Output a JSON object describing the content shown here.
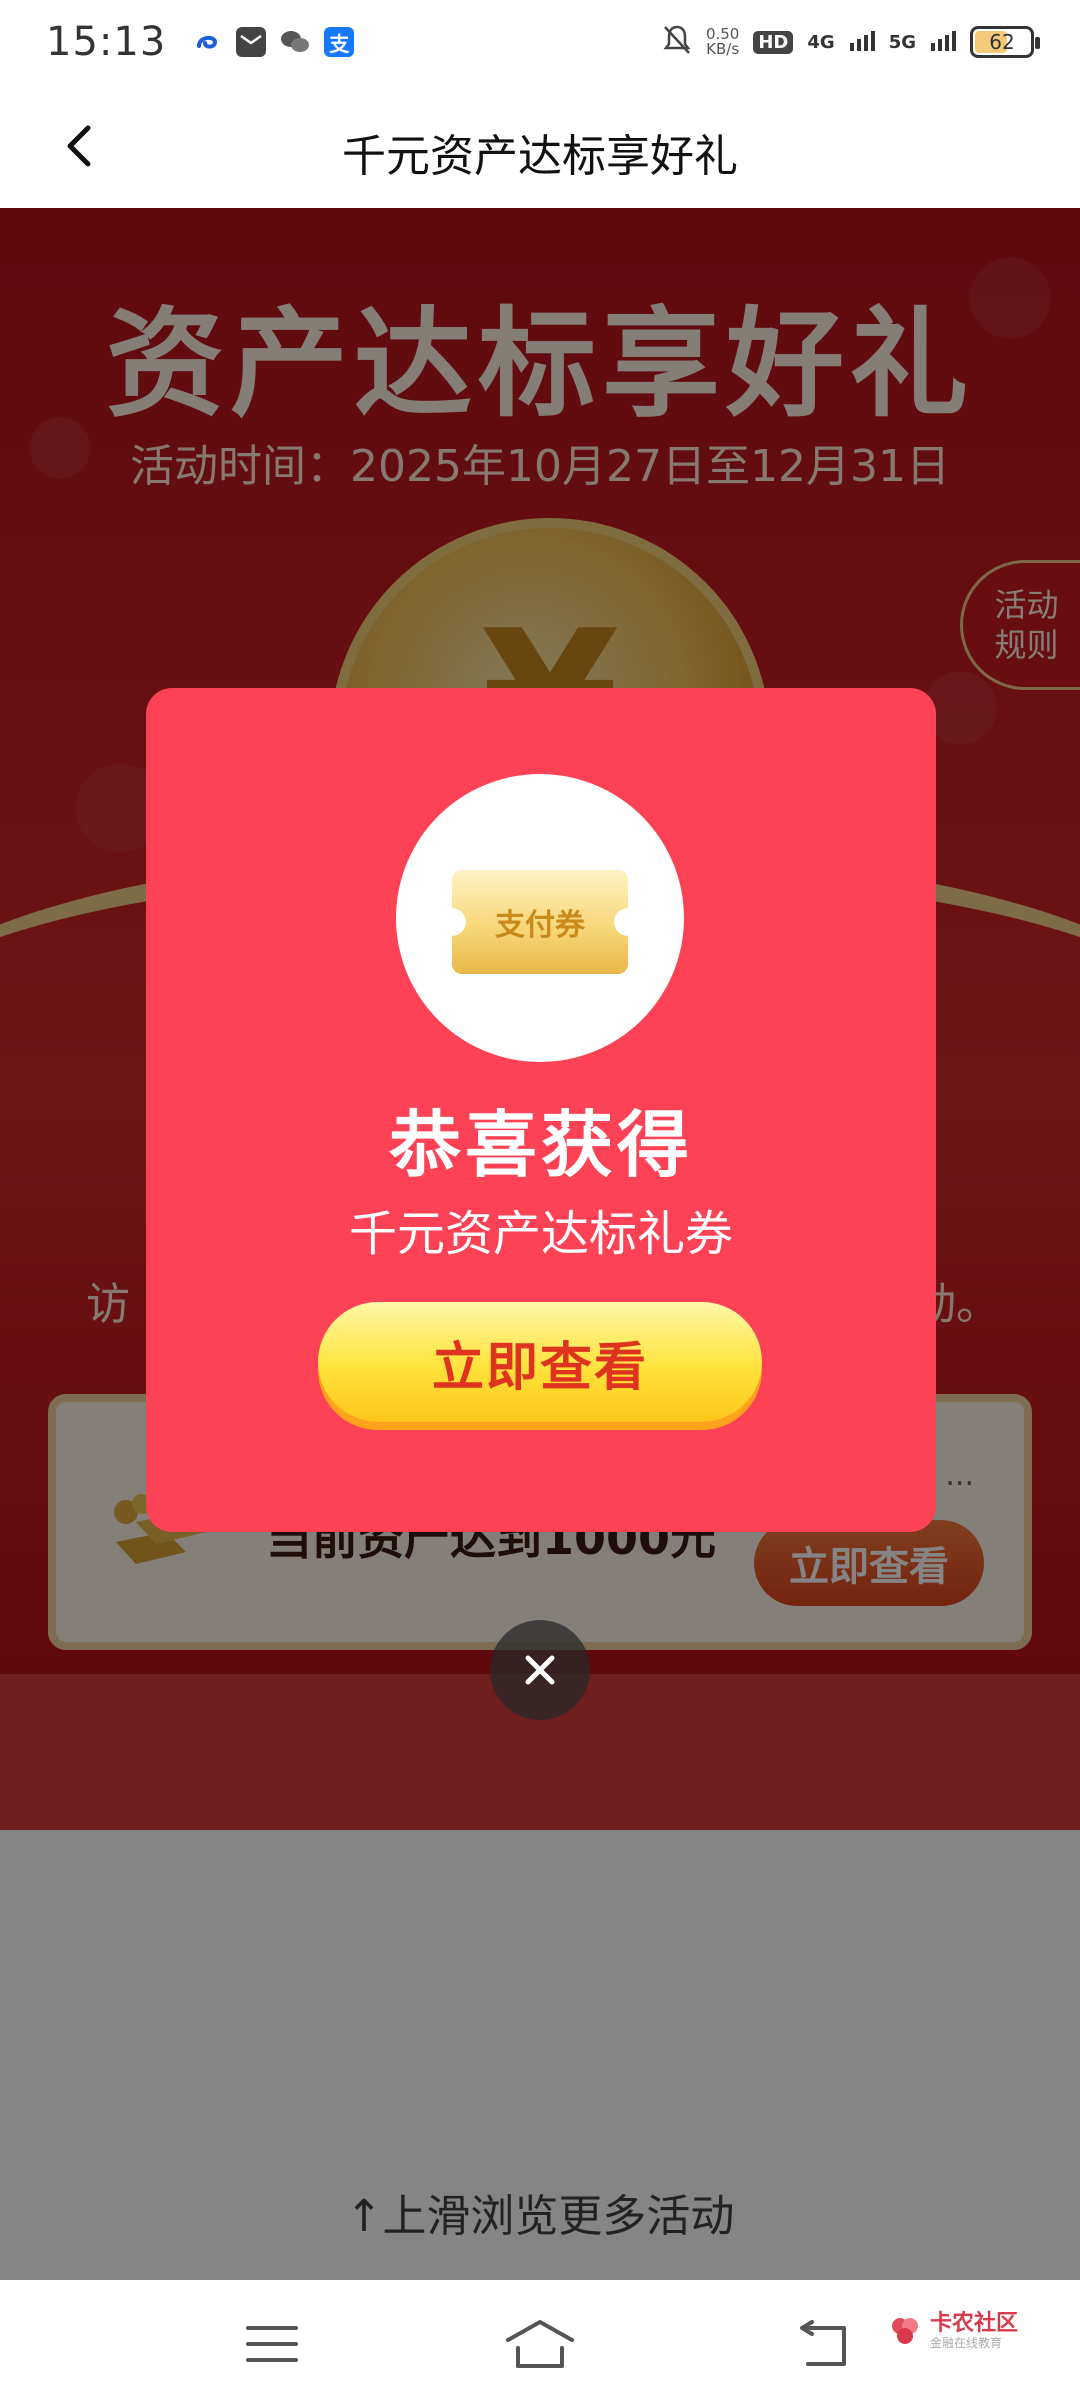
{
  "status_bar": {
    "time": "15:13",
    "apps": [
      {
        "icon": "swirl-app-icon",
        "color": "#1a5fd6",
        "label": ""
      },
      {
        "icon": "mail-app-icon",
        "color": "#444444",
        "label": ""
      },
      {
        "icon": "wechat-icon",
        "color": "#555555",
        "label": ""
      },
      {
        "icon": "alipay-icon",
        "color": "#1677ff",
        "label": "支"
      }
    ],
    "net_speed_value": "0.50",
    "net_speed_unit": "KB/s",
    "hd_label": "HD",
    "net1": "4G",
    "net2": "5G",
    "battery": "62",
    "battery_level": 0.62
  },
  "title_bar": {
    "title": "千元资产达标享好礼",
    "back_icon": "chevron-left-icon"
  },
  "hero": {
    "title": "资产达标享好礼",
    "date": "活动时间：2025年10月27日至12月31日",
    "rules_line1": "活动",
    "rules_line2": "规则",
    "desc_left": "访",
    "desc_right": "动。",
    "task_text": "当前资产达到1000元",
    "task_more": "...",
    "task_button": "立即查看"
  },
  "modal": {
    "ticket_label": "支付券",
    "title": "恭喜获得",
    "subtitle": "千元资产达标礼券",
    "button": "立即查看",
    "close_icon": "close-icon"
  },
  "footer": {
    "swipe_hint": "↑上滑浏览更多活动"
  },
  "nav_bar": {
    "menu_icon": "menu-icon",
    "home_icon": "home-icon",
    "back_icon": "back-arrow-icon"
  },
  "watermark": {
    "main": "卡农社区",
    "sub": "金融在线教育"
  },
  "colors": {
    "hero_red": "#c51d22",
    "modal_red": "#fe4256",
    "button_yellow": "#ffe23a",
    "button_text": "#e0331f"
  }
}
